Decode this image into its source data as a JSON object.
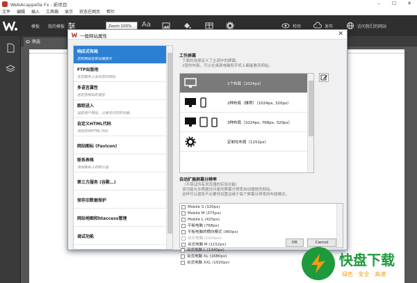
{
  "window": {
    "title": "WebAcappella Fx - 新项目",
    "min": "–",
    "max": "☐",
    "close": "✕"
  },
  "menu": [
    "文件",
    "编辑",
    "插入",
    "工具箱",
    "显示",
    "状态在网页",
    "帮忙"
  ],
  "toolbar": {
    "template_label": "模板",
    "my_template_label": "我的模板",
    "zoom_value": "Zoom 100%",
    "font_icon_text": "Aa",
    "check_label": "检验",
    "publish_label": "发布",
    "visit_label": "访问我们的网站"
  },
  "tab": {
    "label": "筛选"
  },
  "dialog": {
    "title": "一般网站属性",
    "close": "✕",
    "nav": [
      {
        "title": "响应式布局",
        "desc": "您的网站在移动端显示"
      },
      {
        "title": "FTP出版他",
        "desc": "在您服务上发布您的网站"
      },
      {
        "title": "多语言属性",
        "desc": "选定您网站的语言"
      },
      {
        "title": "跟踪进入",
        "desc": "追踪用户网站，以便访问您的页面。"
      },
      {
        "title": "自定义HTML代码",
        "desc": "添加您的HTML代码"
      },
      {
        "title": "网站图标 (Favicon)",
        "desc": ""
      },
      {
        "title": "联系表格",
        "desc": "添加联系人的默认值"
      },
      {
        "title": "第三方服务 (谷歌…)",
        "desc": ""
      },
      {
        "title": "保存旧数据保护",
        "desc": ""
      },
      {
        "title": "网站地图和htaccess管理",
        "desc": ""
      },
      {
        "title": "调试功能",
        "desc": ""
      }
    ],
    "work_screen_title": "工作屏幕",
    "work_screen_desc": [
      "下面的选择定义了主调中的屏幕。",
      "2层的布局，可以在桌面电脑和手机上都能看到网站。"
    ],
    "layouts": [
      "1个布局（1024px）",
      "2种布局（推荐）（1024px, 320px）",
      "3种布局（1024px, 768px, 320px）",
      "定制化布局（1152px）"
    ],
    "auto_title": "自动扩展屏幕分辨率",
    "auto_desc": [
      "（不保证所有浏览器的实验功能）",
      "该功能允许根据访问者的屏幕分辨率自动缩放的网站。",
      "这样可以避免不必要地设置边缘于每个屏幕分辨率的布局模式。"
    ],
    "breakpoints": [
      {
        "label": "Mobile S (320px)",
        "disabled": false
      },
      {
        "label": "Mobile M (375px)",
        "disabled": false
      },
      {
        "label": "Mobile L (425px)",
        "disabled": false
      },
      {
        "label": "平板电脑 (768px)",
        "disabled": false
      },
      {
        "label": "平板电脑的横向模式 (960px)",
        "disabled": false
      },
      {
        "label": "台式电脑 (1024px)",
        "disabled": true
      },
      {
        "label": "台式电脑 M (1152px)",
        "disabled": false
      },
      {
        "label": "台式电脑 L (1440px)",
        "disabled": false
      },
      {
        "label": "台式电脑 XL (1680px)",
        "disabled": false
      },
      {
        "label": "台式电脑 XXL (1920px)",
        "disabled": false
      }
    ],
    "ok_label": "OK",
    "cancel_label": "Cancel"
  },
  "watermark": {
    "brand": "快盘下载",
    "slogan": "绿色 · 安全 · 高速"
  },
  "colors": {
    "toolbar_bg": "#2f2f2f",
    "selection": "#2d7fd3",
    "layout_sel": "#7a7a7a",
    "brand_red": "#c0392b",
    "watermark_green": "#1e9a3c",
    "watermark_orange": "#f39c12"
  }
}
